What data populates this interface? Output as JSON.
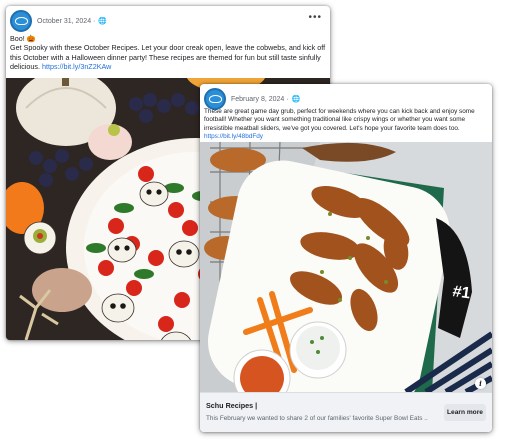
{
  "post1": {
    "date": "October 31, 2024 · ",
    "globe_icon": "globe-icon",
    "more_icon": "more-options-icon",
    "more_glyph": "•••",
    "lines": [
      "Boo! 🎃",
      "Get Spooky with these October Recipes. Let your door creak open, leave the cobwebs, and kick off",
      "this October with a Halloween dinner party! These recipes are themed for fun but still taste sinfully",
      "delicious. "
    ],
    "link": "https://bit.ly/3nZ2KAw",
    "image": "halloween-platter-photo"
  },
  "post2": {
    "date": "February 8, 2024 · ",
    "lines": [
      "These are great game day grub, perfect for weekends where you can kick back and enjoy some",
      "football! Whether you want something traditional like crispy wings or whether you want some",
      "irresistible meatball sliders, we've got you covered. Let's hope your favorite team does too."
    ],
    "link": "https://bit.ly/48bdFdy",
    "image": "chicken-wings-photo",
    "info_glyph": "i",
    "footer": {
      "title": "Schu Recipes |",
      "description": "This February we wanted to share 2 of our families' favorite Super Bowl Eats ...",
      "button_label": "Learn more"
    }
  }
}
